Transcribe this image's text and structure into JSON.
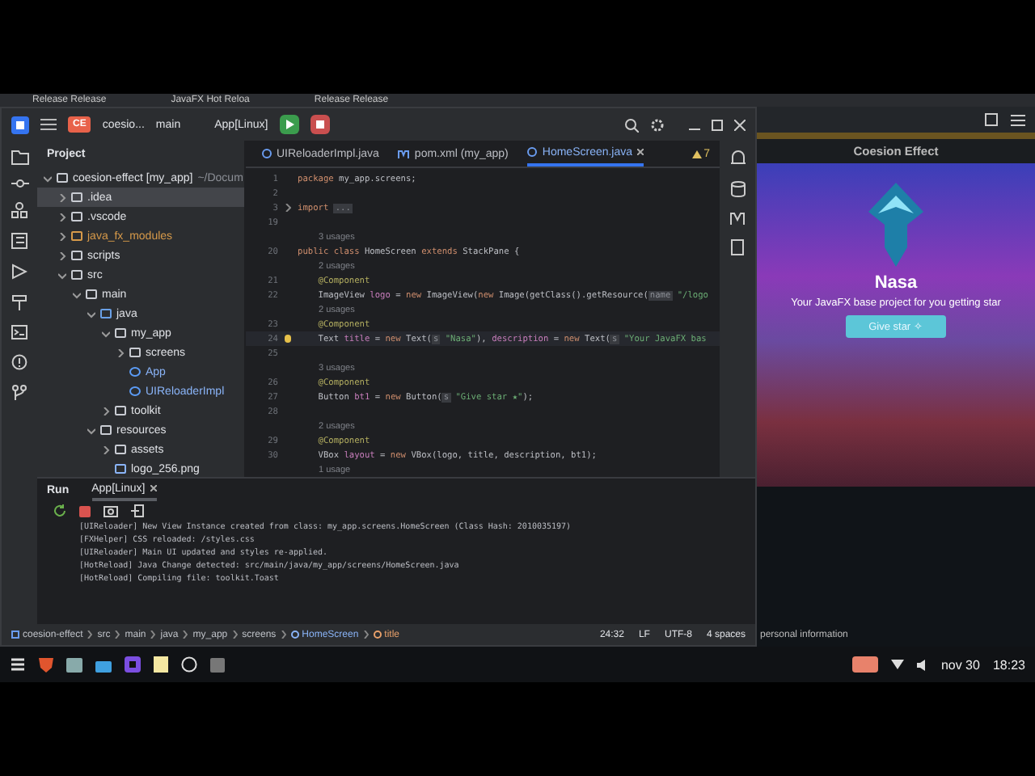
{
  "browser_tabs": [
    {
      "label": "Release Release"
    },
    {
      "label": "JavaFX Hot Reloa"
    },
    {
      "label": "Release Release"
    }
  ],
  "ide": {
    "badge": "CE",
    "project": "coesio...",
    "branch": "main",
    "run_config": "App[Linux]",
    "project_panel": {
      "title": "Project",
      "tree": [
        {
          "label": "coesion-effect [my_app]",
          "suffix": "~/Docum",
          "kind": "module",
          "expanded": true,
          "selected": false,
          "children": [
            {
              "label": ".idea",
              "kind": "folder",
              "expanded": false,
              "selected": true
            },
            {
              "label": ".vscode",
              "kind": "folder",
              "expanded": false,
              "selected": false
            },
            {
              "label": "java_fx_modules",
              "kind": "excluded",
              "expanded": false,
              "selected": false
            },
            {
              "label": "scripts",
              "kind": "folder",
              "expanded": false,
              "selected": false
            },
            {
              "label": "src",
              "kind": "folder",
              "expanded": true,
              "selected": false,
              "children": [
                {
                  "label": "main",
                  "kind": "folder",
                  "expanded": true,
                  "selected": false,
                  "children": [
                    {
                      "label": "java",
                      "kind": "source",
                      "expanded": true,
                      "selected": false,
                      "children": [
                        {
                          "label": "my_app",
                          "kind": "package",
                          "expanded": true,
                          "selected": false,
                          "children": [
                            {
                              "label": "screens",
                              "kind": "package",
                              "expanded": false,
                              "selected": false
                            },
                            {
                              "label": "App",
                              "kind": "class",
                              "selected": false
                            },
                            {
                              "label": "UIReloaderImpl",
                              "kind": "class",
                              "selected": false
                            }
                          ]
                        },
                        {
                          "label": "toolkit",
                          "kind": "package",
                          "expanded": false,
                          "selected": false
                        }
                      ]
                    },
                    {
                      "label": "resources",
                      "kind": "folder",
                      "expanded": true,
                      "selected": false,
                      "children": [
                        {
                          "label": "assets",
                          "kind": "folder",
                          "expanded": false,
                          "selected": false
                        },
                        {
                          "label": "logo_256.png",
                          "kind": "image",
                          "selected": false
                        }
                      ]
                    }
                  ]
                }
              ]
            }
          ]
        }
      ]
    },
    "editor_tabs": [
      {
        "label": "UIReloaderImpl.java",
        "kind": "class",
        "selected": false
      },
      {
        "label": "pom.xml (my_app)",
        "kind": "maven",
        "selected": false
      },
      {
        "label": "HomeScreen.java",
        "kind": "class",
        "selected": true
      }
    ],
    "warnings": "7",
    "code": [
      {
        "number": "1",
        "parts": [
          {
            "kind": "kw",
            "text": "package "
          },
          {
            "kind": "plain",
            "text": "my_app.screens;"
          }
        ]
      },
      {
        "number": "2"
      },
      {
        "number": "3",
        "folded": true,
        "parts": [
          {
            "kind": "kw",
            "text": "import "
          },
          {
            "kind": "hint",
            "text": "..."
          }
        ]
      },
      {
        "number": "19"
      },
      {
        "kind": "usages",
        "text": "3 usages"
      },
      {
        "number": "20",
        "parts": [
          {
            "kind": "kw",
            "text": "public class "
          },
          {
            "kind": "plain",
            "text": "HomeScreen "
          },
          {
            "kind": "kw",
            "text": "extends "
          },
          {
            "kind": "plain",
            "text": "StackPane {"
          }
        ]
      },
      {
        "kind": "usages",
        "text": "2 usages"
      },
      {
        "number": "21",
        "parts": [
          {
            "kind": "ann",
            "text": "    @Component"
          }
        ]
      },
      {
        "number": "22",
        "parts": [
          {
            "kind": "plain",
            "text": "    ImageView "
          },
          {
            "kind": "field",
            "text": "logo"
          },
          {
            "kind": "plain",
            "text": " = "
          },
          {
            "kind": "kw",
            "text": "new "
          },
          {
            "kind": "plain",
            "text": "ImageView("
          },
          {
            "kind": "kw",
            "text": "new "
          },
          {
            "kind": "plain",
            "text": "Image(getClass().getResource("
          },
          {
            "kind": "hint",
            "text": "name"
          },
          {
            "kind": "str",
            "text": " \"/logo"
          }
        ]
      },
      {
        "kind": "usages",
        "text": "2 usages"
      },
      {
        "number": "23",
        "parts": [
          {
            "kind": "ann",
            "text": "    @Component"
          }
        ]
      },
      {
        "number": "24",
        "current": true,
        "parts": [
          {
            "kind": "plain",
            "text": "    Text "
          },
          {
            "kind": "field",
            "text": "title"
          },
          {
            "kind": "plain",
            "text": " = "
          },
          {
            "kind": "kw",
            "text": "new "
          },
          {
            "kind": "plain",
            "text": "Text("
          },
          {
            "kind": "hint",
            "text": "s"
          },
          {
            "kind": "str",
            "text": " \"Nasa\""
          },
          {
            "kind": "plain",
            "text": "), "
          },
          {
            "kind": "field",
            "text": "description"
          },
          {
            "kind": "plain",
            "text": " = "
          },
          {
            "kind": "kw",
            "text": "new "
          },
          {
            "kind": "plain",
            "text": "Text("
          },
          {
            "kind": "hint",
            "text": "s"
          },
          {
            "kind": "str",
            "text": " \"Your JavaFX bas"
          }
        ]
      },
      {
        "number": "25"
      },
      {
        "kind": "usages",
        "text": "3 usages"
      },
      {
        "number": "26",
        "parts": [
          {
            "kind": "ann",
            "text": "    @Component"
          }
        ]
      },
      {
        "number": "27",
        "parts": [
          {
            "kind": "plain",
            "text": "    Button "
          },
          {
            "kind": "field",
            "text": "bt1"
          },
          {
            "kind": "plain",
            "text": " = "
          },
          {
            "kind": "kw",
            "text": "new "
          },
          {
            "kind": "plain",
            "text": "Button("
          },
          {
            "kind": "hint",
            "text": "s"
          },
          {
            "kind": "str",
            "text": " \"Give star ★\""
          },
          {
            "kind": "plain",
            "text": ");"
          }
        ]
      },
      {
        "number": "28"
      },
      {
        "kind": "usages",
        "text": "2 usages"
      },
      {
        "number": "29",
        "parts": [
          {
            "kind": "ann",
            "text": "    @Component"
          }
        ]
      },
      {
        "number": "30",
        "parts": [
          {
            "kind": "plain",
            "text": "    VBox "
          },
          {
            "kind": "field",
            "text": "layout"
          },
          {
            "kind": "plain",
            "text": " = "
          },
          {
            "kind": "kw",
            "text": "new "
          },
          {
            "kind": "plain",
            "text": "VBox(logo, title, description, bt1);"
          }
        ]
      },
      {
        "kind": "usages",
        "text": "1 usage"
      }
    ],
    "run_panel": {
      "title": "Run",
      "tabs": [
        {
          "label": "App[Linux]",
          "selected": true
        }
      ],
      "log": [
        "[UIReloader] New View Instance created from class: my_app.screens.HomeScreen (Class Hash: 2010035197)",
        "[FXHelper] CSS reloaded: /styles.css",
        "[UIReloader] Main UI updated and styles re-applied.",
        "[HotReload] Java Change detected: src/main/java/my_app/screens/HomeScreen.java",
        "[HotReload] Compiling file: toolkit.Toast"
      ]
    },
    "status_bar": {
      "breadcrumbs": [
        {
          "label": "coesion-effect",
          "kind": "module"
        },
        {
          "label": "src",
          "kind": "plain"
        },
        {
          "label": "main",
          "kind": "plain"
        },
        {
          "label": "java",
          "kind": "plain"
        },
        {
          "label": "my_app",
          "kind": "plain"
        },
        {
          "label": "screens",
          "kind": "plain"
        },
        {
          "label": "HomeScreen",
          "kind": "class"
        },
        {
          "label": "title",
          "kind": "field"
        }
      ],
      "position": "24:32",
      "line_ending": "LF",
      "encoding": "UTF-8",
      "indent": "4 spaces"
    }
  },
  "app_window": {
    "title": "Coesion Effect",
    "heading": "Nasa",
    "description": "Your JavaFX base project for you getting star",
    "button": "Give star ✧",
    "footer": "personal information"
  },
  "taskbar": {
    "date": "nov 30",
    "time": "18:23"
  }
}
